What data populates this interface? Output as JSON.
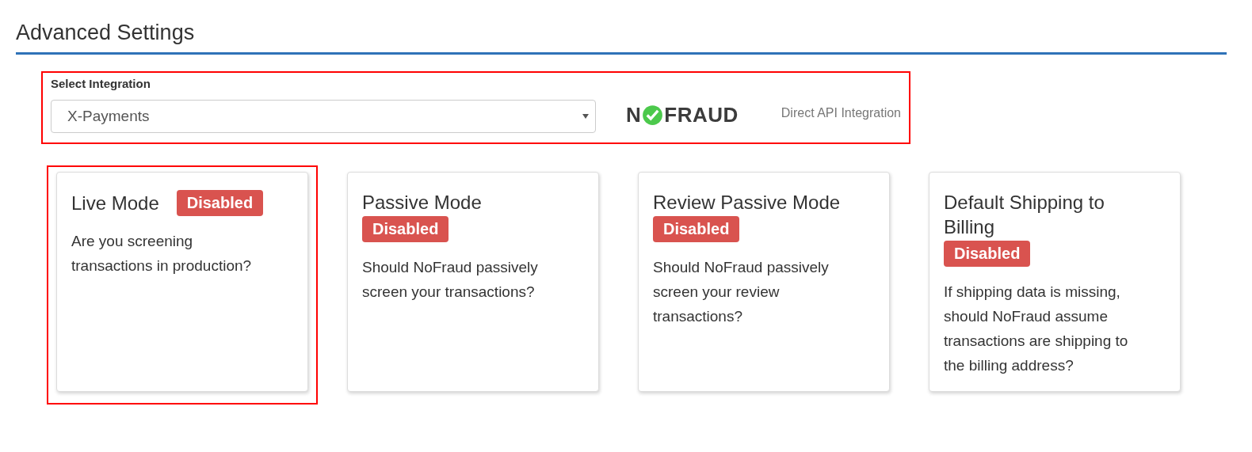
{
  "section": {
    "title": "Advanced Settings"
  },
  "integration": {
    "highlighted": true,
    "label": "Select Integration",
    "value": "X-Payments",
    "logo": {
      "before": "N",
      "after": "FRAUD"
    },
    "caption": "Direct API Integration"
  },
  "cards": [
    {
      "title": "Live Mode",
      "status": "Disabled",
      "enabled": false,
      "highlighted": true,
      "description": "Are you screening transactions in production?"
    },
    {
      "title": "Passive Mode",
      "status": "Disabled",
      "enabled": false,
      "highlighted": false,
      "description": "Should NoFraud passively screen your transactions?"
    },
    {
      "title": "Review Passive Mode",
      "status": "Disabled",
      "enabled": false,
      "highlighted": false,
      "description": "Should NoFraud passively screen your review transactions?"
    },
    {
      "title": "Default Shipping to Billing",
      "status": "Disabled",
      "enabled": false,
      "highlighted": false,
      "description": "If shipping data is missing, should NoFraud assume transactions are shipping to the billing address?"
    }
  ]
}
